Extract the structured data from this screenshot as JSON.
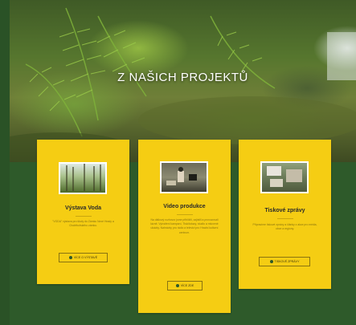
{
  "hero": {
    "title": "Z NAŠICH PROJEKTŮ"
  },
  "cards": [
    {
      "title": "Výstava Voda",
      "desc": "\"VODA\" výstava pro školy do Zámku Nové Hrady a Chotěbořského zámku.",
      "button": "VÍCE O VÝSTAVĚ",
      "thumb_icon": "forest-photo-icon"
    },
    {
      "title": "Video produkce",
      "desc": "Na dálkový rozhovor jsme přiblížili, zajistili a provozovali lázně. Vytváření kampaní, Tisk/dotazy, studio a mluvené ukázky. Nahrávky pro rádio a televizi pro Hradní kulturní centrum.",
      "button": "VÍCE ZDE",
      "thumb_icon": "video-photo-icon"
    },
    {
      "title": "Tiskové zprávy",
      "desc": "Připravíme tiskové zprávy a články z akce pro média, obce a regiony.",
      "button": "TISKOVÉ ZPRÁVY",
      "thumb_icon": "press-photo-icon"
    }
  ],
  "colors": {
    "green": "#2e5a2a",
    "yellow": "#f5cd13"
  }
}
